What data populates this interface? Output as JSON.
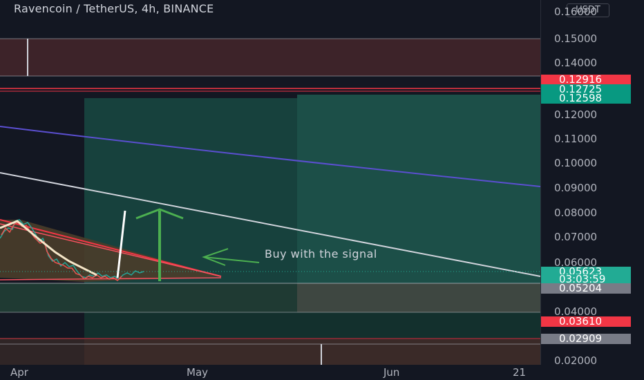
{
  "header": {
    "title": "Ravencoin / TetherUS, 4h, BINANCE",
    "currency": "USDT"
  },
  "price_axis": {
    "labels": [
      "0.16000",
      "0.15000",
      "0.14000",
      "0.12000",
      "0.11000",
      "0.10000",
      "0.09000",
      "0.08000",
      "0.07000",
      "0.06000",
      "0.04000",
      "0.02000"
    ],
    "badges": [
      {
        "text": "0.12916",
        "color": "#f23645"
      },
      {
        "text": "0.12725",
        "color": "#089981"
      },
      {
        "text": "0.12598",
        "color": "#089981"
      },
      {
        "text": "0.05623",
        "color": "#22ab94"
      },
      {
        "text": "03:03:59",
        "color": "#22ab94"
      },
      {
        "text": "0.05204",
        "color": "#787b86"
      },
      {
        "text": "0.03610",
        "color": "#f23645"
      },
      {
        "text": "0.02909",
        "color": "#787b86"
      }
    ]
  },
  "time_axis": {
    "labels": [
      "Apr",
      "May",
      "Jun",
      "21"
    ]
  },
  "annotation": {
    "text": "Buy with the signal"
  },
  "colors": {
    "background": "#131722",
    "long_zone": "#1e5b50",
    "stop_zone": "#4a2a31",
    "wedge_fill": "#4a3d2a",
    "resistance_line": "#f23645",
    "trend_line": "#d1d4dc",
    "blue_line": "#5b4fd1",
    "arrow_green": "#4caf50"
  }
}
